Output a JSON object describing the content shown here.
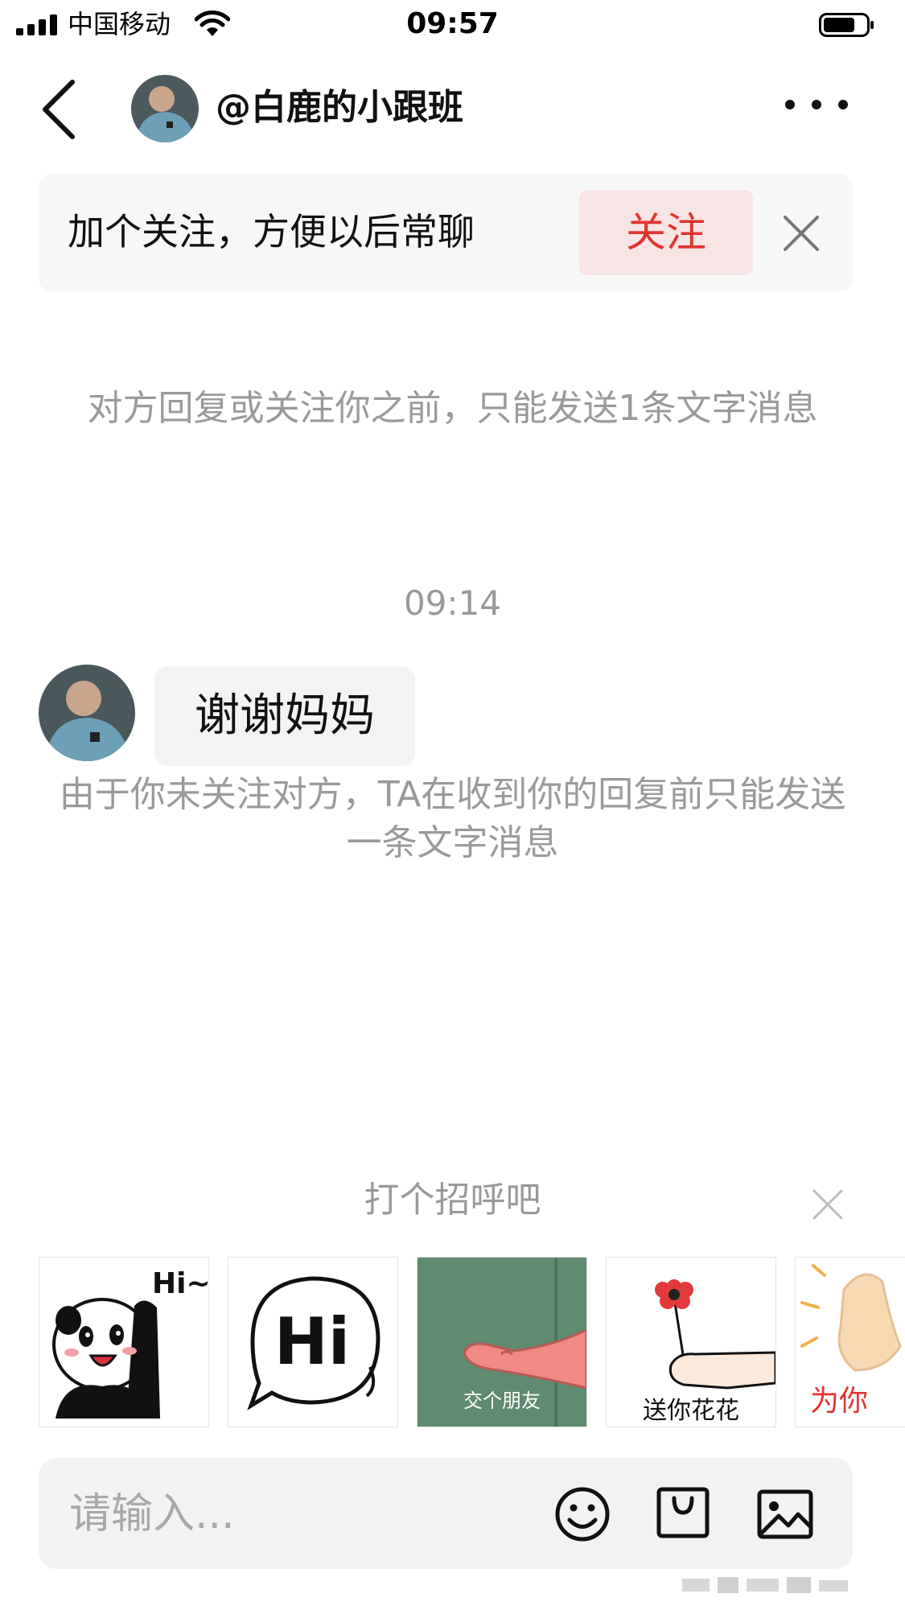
{
  "status_bar": {
    "carrier": "中国移动",
    "time": "09:57"
  },
  "header": {
    "title": "@白鹿的小跟班"
  },
  "follow_banner": {
    "text": "加个关注，方便以后常聊",
    "button_label": "关注"
  },
  "chat": {
    "notice_top": "对方回复或关注你之前，只能发送1条文字消息",
    "timestamp": "09:14",
    "message": "谢谢妈妈",
    "notice_bottom": "由于你未关注对方，TA在收到你的回复前只能发送一条文字消息"
  },
  "greeting": {
    "title": "打个招呼吧",
    "stickers": [
      {
        "name": "panda-hi",
        "text": "Hi~"
      },
      {
        "name": "hi-bubble",
        "text": "Hi"
      },
      {
        "name": "make-friends",
        "text": "交个朋友"
      },
      {
        "name": "give-flower",
        "text": "送你花花"
      },
      {
        "name": "for-you",
        "text": "为你"
      }
    ]
  },
  "input": {
    "placeholder": "请输入..."
  },
  "colors": {
    "accent": "#e0342f",
    "follow_bg": "#f7e4e4",
    "banner_bg": "#f7f7f7",
    "notice_text": "#9a9a9a",
    "bubble_bg": "#f2f3f5"
  }
}
